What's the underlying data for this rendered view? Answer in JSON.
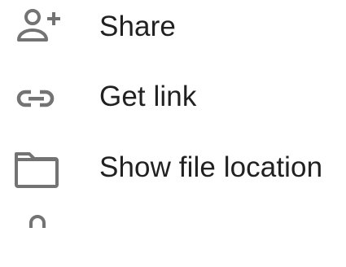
{
  "menu": {
    "items": [
      {
        "label": "Share",
        "icon": "person-add-icon"
      },
      {
        "label": "Get link",
        "icon": "link-icon"
      },
      {
        "label": "Show file location",
        "icon": "folder-icon"
      },
      {
        "label": "",
        "icon": "lock-icon"
      }
    ],
    "icon_color": "#737373",
    "text_color": "#212121"
  }
}
